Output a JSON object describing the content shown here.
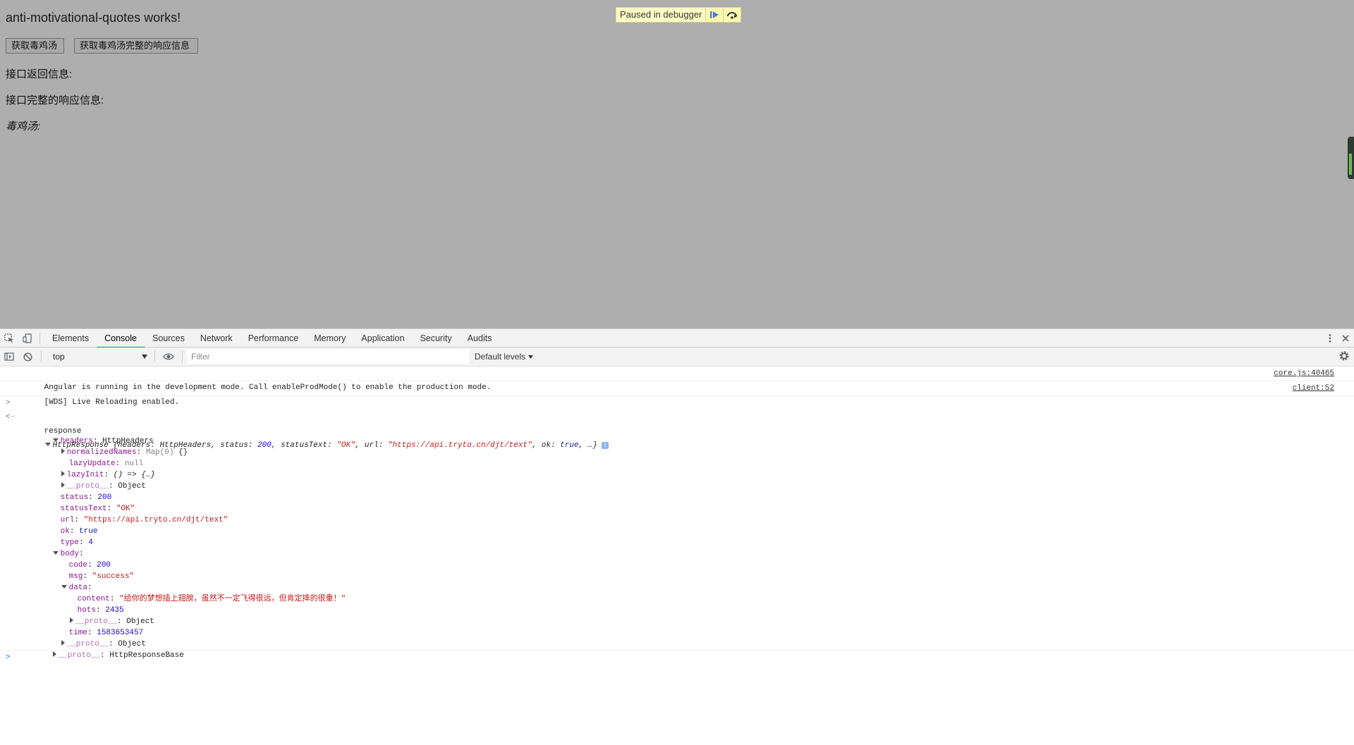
{
  "page": {
    "title": "anti-motivational-quotes works!",
    "buttons": {
      "get_quote": "获取毒鸡汤",
      "get_full_response": "获取毒鸡汤完整的响应信息"
    },
    "labels": {
      "response_info": "接口返回信息:",
      "full_response_info": "接口完整的响应信息:",
      "quote": "毒鸡汤:"
    }
  },
  "debugger": {
    "paused_text": "Paused in debugger",
    "resume_icon": "resume-icon",
    "step_over_icon": "step-over-icon"
  },
  "devtools": {
    "tabs": [
      "Elements",
      "Console",
      "Sources",
      "Network",
      "Performance",
      "Memory",
      "Application",
      "Security",
      "Audits"
    ],
    "active_tab": "Console",
    "console_toolbar": {
      "context": "top",
      "filter_placeholder": "Filter",
      "levels": "Default levels"
    },
    "messages": [
      {
        "text": "Angular is running in the development mode. Call enableProdMode() to enable the production mode.",
        "source": "core.js:40465"
      },
      {
        "text": "[WDS] Live Reloading enabled.",
        "source": "client:52"
      }
    ],
    "command": "response",
    "result": {
      "summary_class": "HttpResponse",
      "summary_open": " {",
      "summary_headers": "headers: HttpHeaders, ",
      "summary_status_key": "status: ",
      "summary_status_val": "200",
      "summary_statustext_key": ", statusText: ",
      "summary_statustext_val": "\"OK\"",
      "summary_url_key": ", url: ",
      "summary_url_val": "\"https://api.tryto.cn/djt/text\"",
      "summary_ok_key": ", ok: ",
      "summary_ok_val": "true",
      "summary_tail": ", …}",
      "headers_key": "headers",
      "headers_val": "HttpHeaders",
      "normalized_key": "normalizedNames",
      "normalized_val_type": "Map(0)",
      "normalized_val_body": " {}",
      "lazyupdate_key": "lazyUpdate",
      "lazyupdate_val": "null",
      "lazyinit_key": "lazyInit",
      "lazyinit_val": "() => {…}",
      "proto_key": "__proto__",
      "proto_object": "Object",
      "status_key": "status",
      "status_val": "200",
      "statustext_key": "statusText",
      "statustext_val": "\"OK\"",
      "url_key": "url",
      "url_val": "\"https://api.tryto.cn/djt/text\"",
      "ok_key": "ok",
      "ok_val": "true",
      "type_key": "type",
      "type_val": "4",
      "body_key": "body",
      "code_key": "code",
      "code_val": "200",
      "msg_key": "msg",
      "msg_val": "\"success\"",
      "data_key": "data",
      "content_key": "content",
      "content_val": "\"给你的梦想插上翅膀，虽然不一定飞得很远，但肯定摔的很重！\"",
      "hots_key": "hots",
      "hots_val": "2435",
      "time_key": "time",
      "time_val": "1583653457",
      "proto_base": "HttpResponseBase"
    }
  }
}
